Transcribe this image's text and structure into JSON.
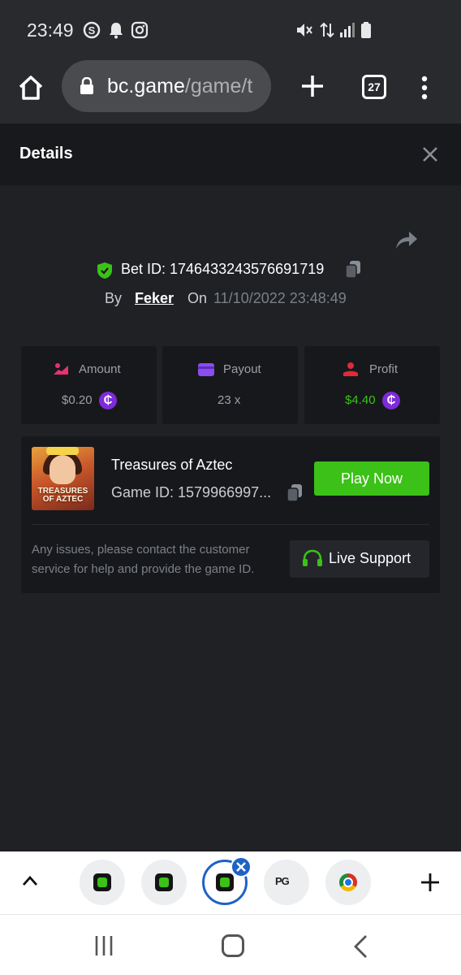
{
  "status_bar": {
    "time": "23:49",
    "left_icons": [
      "skype-icon",
      "bell-icon",
      "instagram-icon"
    ],
    "right_icons": [
      "mute-icon",
      "data-arrows-icon",
      "signal-icon",
      "battery-icon"
    ]
  },
  "browser": {
    "url_domain": "bc.game",
    "url_path": "/game/t",
    "tab_count": "27"
  },
  "details": {
    "title": "Details"
  },
  "bet": {
    "bet_id": "Bet ID: 1746433243576691719",
    "by_label": "By",
    "username": "Feker",
    "on_label": "On",
    "timestamp": "11/10/2022 23:48:49"
  },
  "stats": {
    "amount": {
      "label": "Amount",
      "value": "$0.20",
      "icon": "amount-icon"
    },
    "payout": {
      "label": "Payout",
      "value": "23 x",
      "icon": "wallet-icon"
    },
    "profit": {
      "label": "Profit",
      "value": "$4.40",
      "icon": "profit-icon"
    },
    "coin_symbol": "₵"
  },
  "game": {
    "name": "Treasures of Aztec",
    "game_id": "Game ID: 1579966997...",
    "thumb_title": "TREASURES OF AZTEC",
    "play_label": "Play Now",
    "issue_text": "Any issues, please contact the customer service for help and provide the game ID.",
    "support_label": "Live Support"
  },
  "tab_strip": {
    "apps": [
      "bc-game-app",
      "bc-game-app",
      "bc-game-app",
      "pg-app",
      "chrome-app"
    ],
    "active_index": 2,
    "pg_label": "PG"
  },
  "colors": {
    "accent_green": "#3bc117",
    "amount_pink": "#e8326b",
    "payout_purple": "#8b4cf0",
    "profit_red": "#e02a3a",
    "profit_value_green": "#3bc117",
    "coin_purple": "#7e2bd9",
    "active_tab_blue": "#1d62c7"
  }
}
